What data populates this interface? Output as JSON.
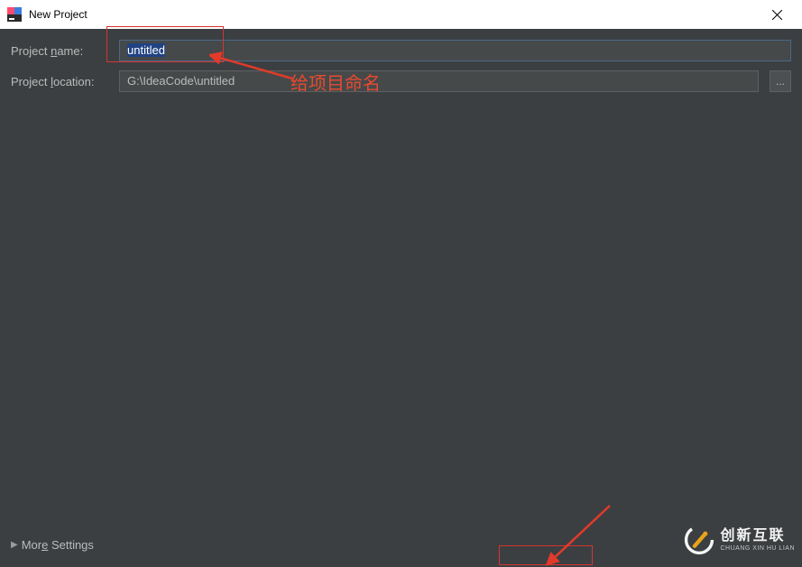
{
  "titlebar": {
    "title": "New Project",
    "close_label": "✕"
  },
  "form": {
    "name_label_pre": "Project ",
    "name_label_u": "n",
    "name_label_post": "ame:",
    "name_value": "untitled",
    "location_label_pre": "Project ",
    "location_label_u": "l",
    "location_label_post": "ocation:",
    "location_value": "G:\\IdeaCode\\untitled",
    "browse_label": "..."
  },
  "more_settings": {
    "arrow": "▶",
    "label_pre": "Mor",
    "label_u": "e",
    "label_post": " Settings"
  },
  "annotation": {
    "text": "给项目命名"
  },
  "watermark": {
    "cn": "创新互联",
    "en": "CHUANG XIN HU LIAN"
  }
}
